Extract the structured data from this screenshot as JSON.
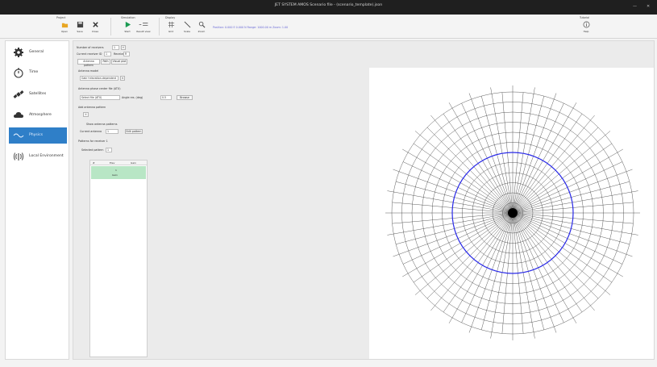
{
  "window": {
    "title": "JET SYSTEM AMOS Scenario file - (scenario_template).json",
    "min": "—",
    "close": "✕"
  },
  "ribbon": {
    "groups": [
      {
        "title": "Project",
        "buttons": [
          {
            "label": "Open",
            "icon": "folder-open-icon"
          },
          {
            "label": "Save",
            "icon": "save-icon"
          },
          {
            "label": "Close",
            "icon": "close-icon"
          }
        ]
      },
      {
        "title": "Simulation",
        "buttons": [
          {
            "label": "Start",
            "icon": "play-icon"
          },
          {
            "label": "Result view",
            "icon": "result-view-icon"
          }
        ]
      },
      {
        "title": "Display",
        "buttons": [
          {
            "label": "Grid",
            "icon": "grid-icon"
          },
          {
            "label": "Scale",
            "icon": "ruler-icon"
          },
          {
            "label": "Zoom",
            "icon": "magnify-icon"
          }
        ]
      },
      {
        "title": "Tutorial",
        "buttons": [
          {
            "label": "Help",
            "icon": "info-icon"
          }
        ]
      }
    ],
    "display_info": "Position: 0.000  E   0.000  N   Range: 1000.00 m  Zoom: 1.00"
  },
  "sidebar": {
    "items": [
      {
        "label": "General",
        "icon": "gear-icon",
        "active": false
      },
      {
        "label": "Time",
        "icon": "stopwatch-icon",
        "active": false
      },
      {
        "label": "Satellites",
        "icon": "satellite-icon",
        "active": false
      },
      {
        "label": "Atmosphere",
        "icon": "cloud-icon",
        "active": false
      },
      {
        "label": "Physics",
        "icon": "physics-icon",
        "active": true
      },
      {
        "label": "Local Environment",
        "icon": "antenna-icon",
        "active": false
      }
    ]
  },
  "physics": {
    "num_receivers_label": "Number of receivers",
    "num_receivers_value": "1",
    "current_receiver_label": "Current receiver ID",
    "current_receiver_value": "1",
    "receiver_label": "Receiver",
    "receiver_value": "R",
    "tabs": [
      "Antenna pattern",
      "Path",
      "Visual plot"
    ],
    "antenna_model_label": "Antenna model",
    "antenna_model_value": "Gain+elevation-dependent",
    "file_label": "Antenna phase center file (ATX)",
    "file_value": "Select file (ATX)",
    "angle_res_label": "Angle res. (deg)",
    "angle_res_value": "0.5",
    "browse_label": "Browse",
    "add_pattern_label": "Add antenna pattern",
    "add_button_label": "+",
    "show_patterns_label": "Show antenna patterns",
    "current_antenna_label": "Current antenna",
    "current_antenna_value": "1",
    "edit_label": "Edit pattern",
    "patterns_label": "Patterns for receiver 1",
    "selected_pattern_label": "Selected pattern",
    "selected_pattern_value": "1",
    "table_headers": [
      "#",
      "Elev",
      "Gain"
    ],
    "table_rows": [
      {
        "id": "1",
        "value": "Gain"
      }
    ]
  },
  "plot": {
    "type": "polar antenna pattern",
    "grid_color": "#333333",
    "pattern_color": "#2a2ae8",
    "pattern_radius_fraction": 0.5
  },
  "colors": {
    "accent": "#2f7fc8",
    "selected_row": "#b8e6c5"
  }
}
